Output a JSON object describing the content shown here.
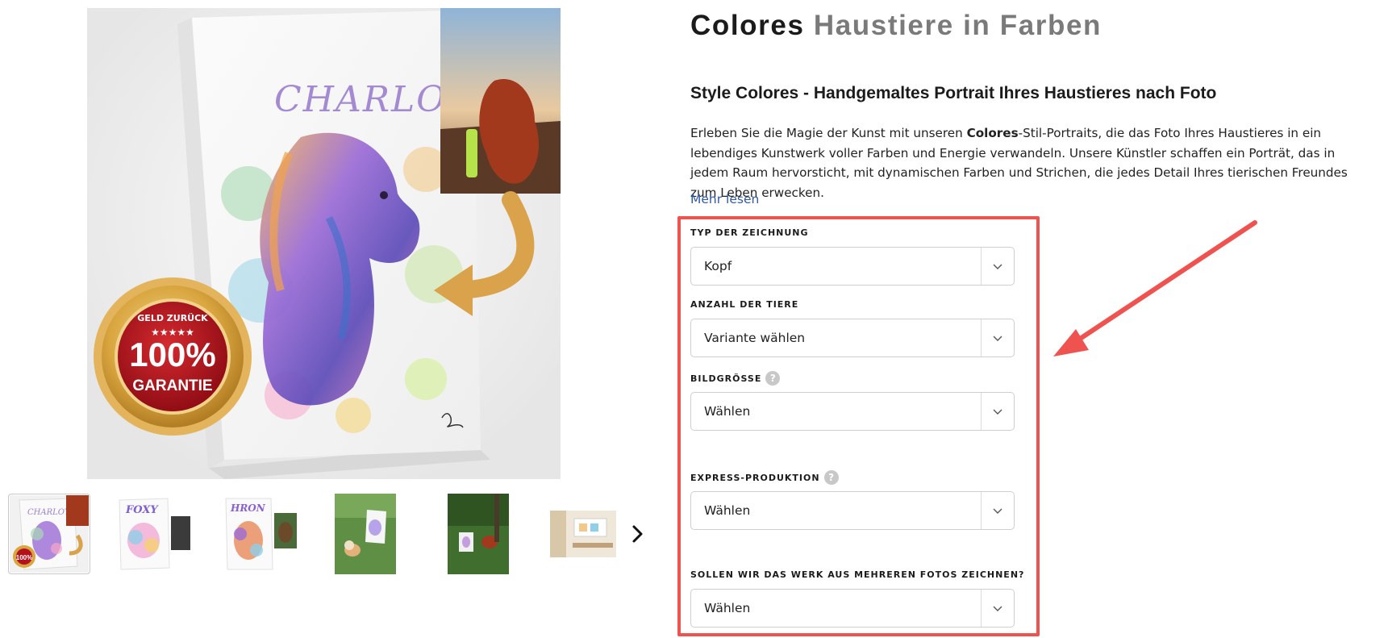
{
  "product": {
    "title_main": "Colores",
    "title_sub": "Haustiere in Farben",
    "subtitle": "Style Colores - Handgemaltes Portrait Ihres Haustieres nach Foto",
    "description": {
      "before": "Erleben Sie die Magie der Kunst mit unseren ",
      "bold": "Colores",
      "after": "-Stil-Portraits, die das Foto Ihres Haustieres in ein lebendiges Kunstwerk voller Farben und Energie verwandeln. Unsere Künstler schaffen ein Porträt, das in jedem Raum hervorsticht, mit dynamischen Farben und Strichen, die jedes Detail Ihres tierischen Freundes zum Leben erwecken."
    },
    "more_link": "Mehr lesen"
  },
  "gallery": {
    "canvas_name": "CHARLOTA",
    "badge": {
      "top": "GELD ZURÜCK",
      "stars": "★★★★★",
      "big": "100%",
      "bottom": "GARANTIE"
    },
    "thumb_names": [
      "CHARLOTA",
      "FOXY",
      "HRON"
    ],
    "thumb_badge": "100%",
    "next_icon": "chevron-right-icon"
  },
  "options": [
    {
      "label": "TYP DER ZEICHNUNG",
      "value": "Kopf",
      "help": false
    },
    {
      "label": "ANZAHL DER TIERE",
      "value": "Variante wählen",
      "help": false
    },
    {
      "label": "BILDGRÖSSE",
      "value": "Wählen",
      "help": true
    },
    {
      "label": "EXPRESS-PRODUKTION",
      "value": "Wählen",
      "help": true
    },
    {
      "label": "SOLLEN WIR DAS WERK AUS MEHREREN FOTOS ZEICHNEN?",
      "value": "Wählen",
      "help": false
    }
  ],
  "help_glyph": "?",
  "colors": {
    "annotation_red": "#ef5350",
    "link_blue": "#2f5aa6",
    "badge_red": "#b3121c",
    "badge_gold": "#d9a640",
    "arrow_gold": "#d9a24b"
  }
}
